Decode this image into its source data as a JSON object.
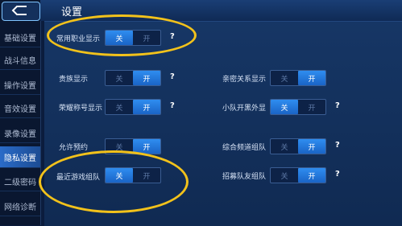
{
  "title": "设置",
  "sidebar": {
    "items": [
      {
        "label": "基础设置",
        "active": false
      },
      {
        "label": "战斗信息",
        "active": false
      },
      {
        "label": "操作设置",
        "active": false
      },
      {
        "label": "音效设置",
        "active": false
      },
      {
        "label": "录像设置",
        "active": false
      },
      {
        "label": "隐私设置",
        "active": true
      },
      {
        "label": "二级密码",
        "active": false
      },
      {
        "label": "网络诊断",
        "active": false
      }
    ]
  },
  "toggle_labels": {
    "off": "关",
    "on": "开"
  },
  "help_mark": "?",
  "settings": [
    {
      "label": "常用职业显示",
      "state": "off",
      "help": true
    },
    {
      "label": "贵族显示",
      "state": "on",
      "help": true
    },
    {
      "label": "亲密关系显示",
      "state": "on",
      "help": false
    },
    {
      "label": "荣耀称号显示",
      "state": "on",
      "help": true
    },
    {
      "label": "小队开黑外显",
      "state": "off",
      "help": true
    },
    {
      "label": "允许预约",
      "state": "on",
      "help": false
    },
    {
      "label": "综合频道组队",
      "state": "on",
      "help": true
    },
    {
      "label": "最近游戏组队",
      "state": "off",
      "help": false
    },
    {
      "label": "招募队友组队",
      "state": "on",
      "help": true
    }
  ],
  "colors": {
    "background": "#0b1c3d",
    "accent": "#2f8df0",
    "highlight_circle": "#f2c21b"
  }
}
